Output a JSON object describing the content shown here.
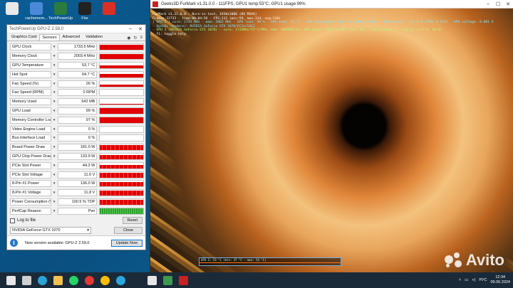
{
  "desktop": {
    "icons": [
      {
        "label": "",
        "color": "#e9e9e9"
      },
      {
        "label": "cachemem...",
        "color": "#4a88d8"
      },
      {
        "label": "TechPowerUp",
        "color": "#2a7b3d"
      },
      {
        "label": "Fire",
        "color": "#222222"
      },
      {
        "label": "",
        "color": "#d93025"
      }
    ]
  },
  "gpuz": {
    "title": "TechPowerUp GPU-Z 2.58.0",
    "tabs": [
      "Graphics Card",
      "Sensors",
      "Advanced",
      "Validation"
    ],
    "active_tab": "Sensors",
    "sensors": [
      {
        "name": "GPU Clock",
        "value": "1733.5 MHz",
        "fill": 0.9,
        "style": "red"
      },
      {
        "name": "Memory Clock",
        "value": "2003.4 MHz",
        "fill": 0.9,
        "style": "red"
      },
      {
        "name": "GPU Temperature",
        "value": "53.7 °C",
        "fill": 0.5,
        "style": "red"
      },
      {
        "name": "Hot Spot",
        "value": "64.7 °C",
        "fill": 0.55,
        "style": "red"
      },
      {
        "name": "Fan Speed (%)",
        "value": "26 %",
        "fill": 0.3,
        "style": "red"
      },
      {
        "name": "Fan Speed (RPM)",
        "value": "0 RPM",
        "fill": 0.0,
        "style": "red"
      },
      {
        "name": "Memory Used",
        "value": "542 MB",
        "fill": 0.15,
        "style": "red"
      },
      {
        "name": "GPU Load",
        "value": "99 %",
        "fill": 0.95,
        "style": "red"
      },
      {
        "name": "Memory Controller Load",
        "value": "97 %",
        "fill": 0.95,
        "style": "red"
      },
      {
        "name": "Video Engine Load",
        "value": "0 %",
        "fill": 0.0,
        "style": "red"
      },
      {
        "name": "Bus Interface Load",
        "value": "0 %",
        "fill": 0.0,
        "style": "red"
      },
      {
        "name": "Board Power Draw",
        "value": "181.0 W",
        "fill": 0.85,
        "style": "spiky"
      },
      {
        "name": "GPU Chip Power Draw",
        "value": "133.9 W",
        "fill": 0.8,
        "style": "spiky"
      },
      {
        "name": "PCIe Slot Power",
        "value": "44.3 W",
        "fill": 0.6,
        "style": "spiky"
      },
      {
        "name": "PCIe Slot Voltage",
        "value": "11.6 V",
        "fill": 0.85,
        "style": "spiky"
      },
      {
        "name": "8-Pin #1 Power",
        "value": "136.0 W",
        "fill": 0.8,
        "style": "spiky"
      },
      {
        "name": "8-Pin #1 Voltage",
        "value": "11.8 V",
        "fill": 0.85,
        "style": "spiky"
      },
      {
        "name": "Power Consumption (%)",
        "value": "100.5 % TDP",
        "fill": 0.85,
        "style": "spiky"
      },
      {
        "name": "PerfCap Reason",
        "value": "Pwr",
        "fill": 1.0,
        "style": "green"
      }
    ],
    "log_to_file_label": "Log to file",
    "reset_label": "Reset",
    "gpu_selected": "NVIDIA GeForce GTX 1070",
    "close_label": "Close",
    "notice_text": "New version available: GPU-Z 2.59.0",
    "update_label": "Update Now"
  },
  "furmark": {
    "title": "Geeks3D FurMark v1.31.0.0 - 111FPS, GPU1 temp:53°C, GPU1 usage:99%",
    "overlay_lines": [
      {
        "text": "FurMark v1.31.0.0 - Burn-in test, 1920x1080 (8X MSAA)",
        "color": "white"
      },
      {
        "text": "Frames:32733 - time:00:04:56 - FPS:111 (min:59, max:114, avg:110)",
        "color": "white"
      },
      {
        "text": "[ GPU-Z ] core: 1733 MHz - mem: 2003 MHz - GPU load: 99 % - GPU temp: 53 °C - GPU chip power: 133.9 W (PPW: 0.829) - Board power: 181.0 W (PPW: 0.613) - GPU voltage: 0.081 V",
        "color": "cyan"
      },
      {
        "text": "- OpenGL renderer: NVIDIA GeForce GTX 1070/PCIe/SSE2",
        "color": "cyan"
      },
      {
        "text": "- GPU 1 (NVIDIA GeForce GTX 1070) - core: 1733MHz/53°C/99%, mem: 4006MHz/6%, GPU power: 100.7% TDP, fan: 26%, limits[power:1, temp:0, volt:0, OV:0]",
        "color": "green"
      },
      {
        "text": "- F1: toggle help",
        "color": "white"
      }
    ],
    "graph_label": "GPU 1: 53 °C (min: 37 °C - max: 54 °C)",
    "watermark": "Avito"
  },
  "taskbar": {
    "apps": [
      {
        "name": "windows-start",
        "color": "#e8e8e8"
      },
      {
        "name": "search",
        "color": "#cfcfcf"
      },
      {
        "name": "edge",
        "color": "#2aa5d6"
      },
      {
        "name": "explorer",
        "color": "#f2c14e"
      },
      {
        "name": "whatsapp",
        "color": "#25d366"
      },
      {
        "name": "yandex",
        "color": "#e53935"
      },
      {
        "name": "chrome",
        "color": "#fbbc04"
      },
      {
        "name": "telegram",
        "color": "#2aa7e0"
      },
      {
        "name": "steam",
        "color": "#1b2838"
      },
      {
        "name": "epic",
        "color": "#e6e6e6"
      },
      {
        "name": "gpuz",
        "color": "#3e9a4e"
      },
      {
        "name": "furmark",
        "color": "#c62222"
      }
    ],
    "lang": "РУС",
    "time": "12:34",
    "date": "09.06.2024"
  }
}
